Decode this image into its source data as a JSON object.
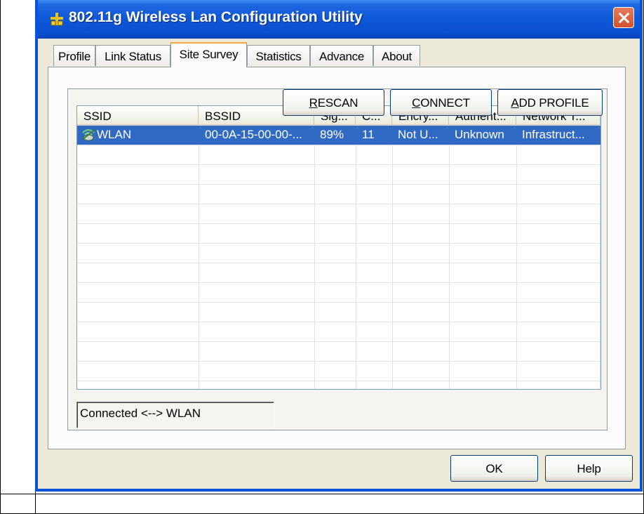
{
  "window": {
    "title": "802.11g Wireless Lan Configuration Utility"
  },
  "tabs": [
    {
      "label": "Profile"
    },
    {
      "label": "Link Status"
    },
    {
      "label": "Site Survey"
    },
    {
      "label": "Statistics"
    },
    {
      "label": "Advance"
    },
    {
      "label": "About"
    }
  ],
  "active_tab": "Site Survey",
  "list": {
    "columns": [
      "SSID",
      "BSSID",
      "Sig...",
      "C...",
      "Encry...",
      "Authent...",
      "Network T..."
    ],
    "rows": [
      {
        "ssid": "WLAN",
        "bssid": "00-0A-15-00-00-...",
        "signal": "89%",
        "channel": "11",
        "encryption": "Not U...",
        "authentication": "Unknown",
        "network_type": "Infrastruct...",
        "selected": true,
        "icon": "wireless-network-icon"
      }
    ]
  },
  "status": {
    "text": "Connected <--> WLAN"
  },
  "buttons": {
    "rescan_first": "R",
    "rescan_rest": "ESCAN",
    "connect_first": "C",
    "connect_rest": "ONNECT",
    "add_profile_first": "A",
    "add_profile_rest": "DD PROFILE",
    "ok": "OK",
    "help": "Help"
  },
  "colors": {
    "selection": "#316ac5",
    "titlebar": "#0a4fd0",
    "face": "#ece9d8",
    "active_tab_accent": "#f7a53d"
  }
}
